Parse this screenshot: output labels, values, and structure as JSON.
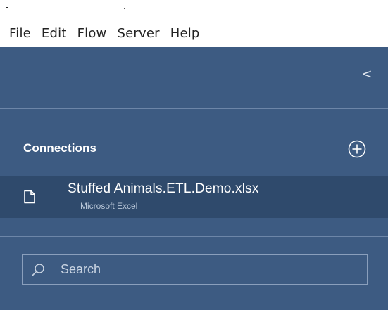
{
  "menubar": {
    "items": [
      "File",
      "Edit",
      "Flow",
      "Server",
      "Help"
    ]
  },
  "panel": {
    "collapse_glyph": "<",
    "connections": {
      "header": "Connections",
      "add_icon": "plus-circle-icon",
      "items": [
        {
          "name": "Stuffed Animals.ETL.Demo.xlsx",
          "type": "Microsoft Excel",
          "icon": "file-icon"
        }
      ]
    },
    "search": {
      "placeholder": "Search",
      "value": ""
    }
  },
  "colors": {
    "panel_bg": "#3d5b82",
    "selected_row_bg": "#2f4a6c",
    "divider": "#6d86a8"
  }
}
